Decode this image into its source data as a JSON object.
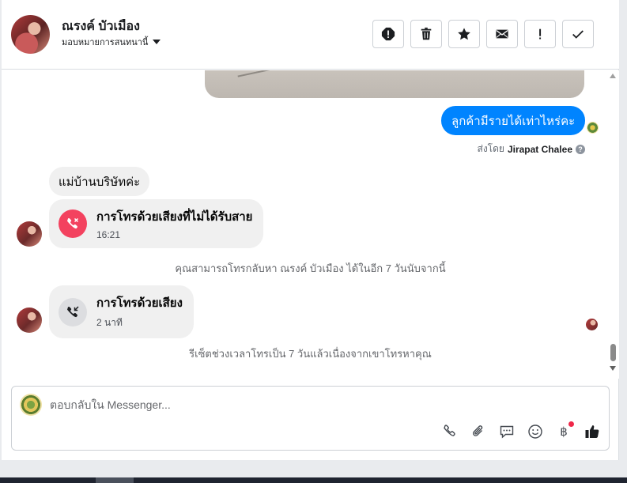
{
  "header": {
    "contact_name": "ณรงค์ บัวเมือง",
    "assign_label": "มอบหมายการสนทนานี้"
  },
  "toolbar": {
    "buttons": [
      "spam-icon",
      "trash-icon",
      "star-icon",
      "envelope-icon",
      "exclamation-icon",
      "checkmark-icon"
    ]
  },
  "thread": {
    "outgoing_message": "ลูกค้ามีรายได้เท่าไหร่คะ",
    "sent_by_prefix": "ส่งโดย",
    "sent_by_name": "Jirapat Chalee",
    "incoming_message": "แม่บ้านบริษัทค่ะ",
    "missed_call": {
      "title": "การโทรด้วยเสียงที่ไม่ได้รับสาย",
      "time": "16:21"
    },
    "callback_note": "คุณสามารถโทรกลับหา ณรงค์ บัวเมือง ได้ในอีก 7 วันนับจากนี้",
    "voice_call": {
      "title": "การโทรด้วยเสียง",
      "duration": "2 นาที"
    },
    "reset_note": "รีเซ็ตช่วงเวลาโทรเป็น 7 วันแล้วเนื่องจากเขาโทรหาคุณ"
  },
  "composer": {
    "placeholder": "ตอบกลับใน Messenger...",
    "tools": [
      "phone-icon",
      "paperclip-icon",
      "saved-reply-icon",
      "emoji-icon",
      "baht-icon",
      "thumbs-up-icon"
    ],
    "baht_symbol": "฿"
  },
  "colors": {
    "messenger_blue": "#0084ff",
    "missed_red": "#f3425f",
    "bubble_gray": "#f0f0f0"
  }
}
